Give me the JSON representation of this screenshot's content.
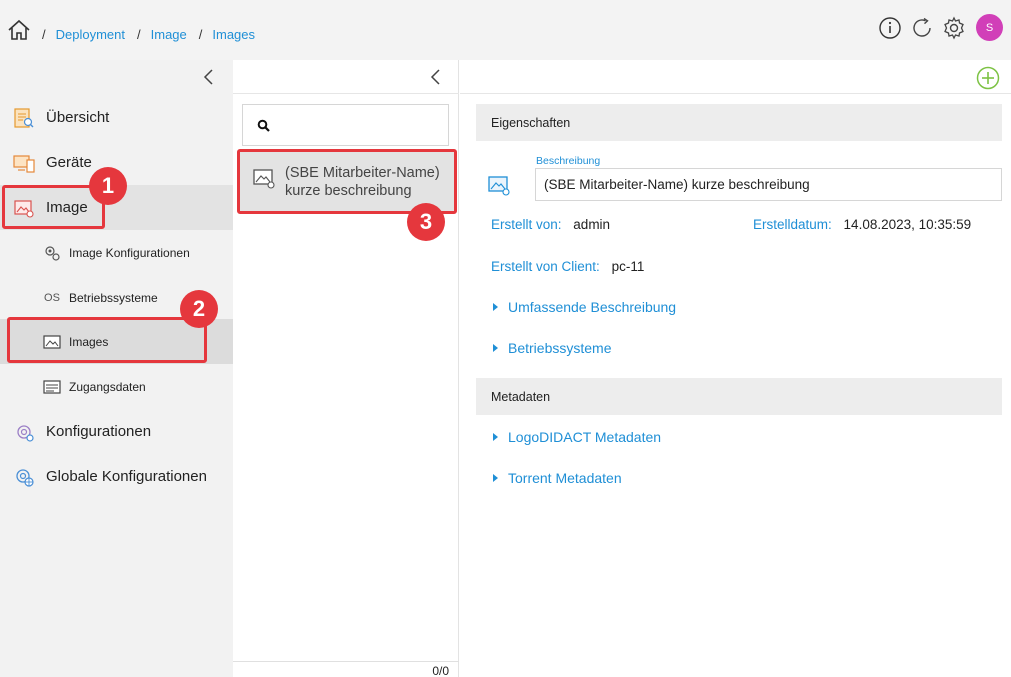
{
  "breadcrumb": {
    "separator": "/",
    "items": [
      "Deployment",
      "Image",
      "Images"
    ]
  },
  "top_icons": [
    "info-icon",
    "refresh-icon",
    "gear-icon"
  ],
  "user": {
    "avatar_initial": "S",
    "avatar_color": "#d13fb8"
  },
  "sidebar": {
    "items": [
      {
        "label": "Übersicht",
        "icon": "overview-icon"
      },
      {
        "label": "Geräte",
        "icon": "devices-icon"
      },
      {
        "label": "Image",
        "icon": "image-icon"
      },
      {
        "label": "Konfigurationen",
        "icon": "configurations-icon"
      },
      {
        "label": "Globale Konfigurationen",
        "icon": "global-configurations-icon"
      }
    ],
    "subitems": [
      {
        "label": "Image Konfigurationen",
        "icon": "image-config-icon"
      },
      {
        "label": "Betriebssysteme",
        "icon_text": "OS"
      },
      {
        "label": "Images",
        "icon": "image-icon"
      },
      {
        "label": "Zugangsdaten",
        "icon": "credentials-icon"
      }
    ]
  },
  "list": {
    "search_value": "",
    "entries": [
      {
        "title": "(SBE Mitarbeiter-Name) kurze beschreibung"
      }
    ],
    "pager": "0/0"
  },
  "detail": {
    "properties_header": "Eigenschaften",
    "description_label": "Beschreibung",
    "description_value": "(SBE Mitarbeiter-Name) kurze beschreibung",
    "created_by_label": "Erstellt von:",
    "created_by_value": "admin",
    "created_date_label": "Erstelldatum:",
    "created_date_value": "14.08.2023, 10:35:59",
    "created_client_label": "Erstellt von Client:",
    "created_client_value": "pc-11",
    "expanders": [
      "Umfassende Beschreibung",
      "Betriebssysteme"
    ],
    "metadata_header": "Metadaten",
    "metadata_expanders": [
      "LogoDIDACT Metadaten",
      "Torrent Metadaten"
    ]
  },
  "annotations": [
    "1",
    "2",
    "3"
  ],
  "colors": {
    "accent": "#1f8fd6",
    "annotation": "#e5373d",
    "add": "#7cc243"
  }
}
